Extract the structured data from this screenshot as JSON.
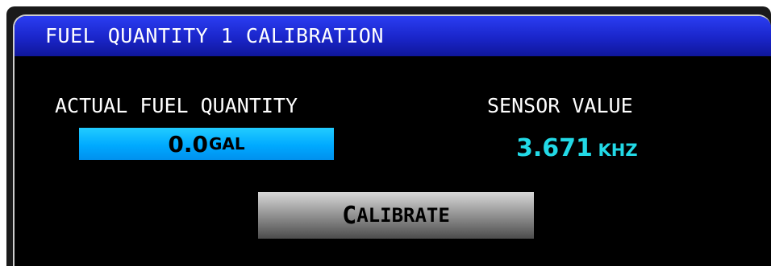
{
  "window": {
    "title": "FUEL QUANTITY 1 CALIBRATION"
  },
  "actual_fuel": {
    "label": "ACTUAL FUEL QUANTITY",
    "value": "0.0",
    "unit": "GAL"
  },
  "sensor": {
    "label": "SENSOR VALUE",
    "value": "3.671",
    "unit": "KHZ"
  },
  "calibrate_button": {
    "label_initial": "C",
    "label_rest": "ALIBRATE"
  },
  "colors": {
    "title_bar": "#1a25c9",
    "input_field": "#00aaff",
    "sensor_value": "#22d9e6",
    "button": "#8a8a8a"
  }
}
